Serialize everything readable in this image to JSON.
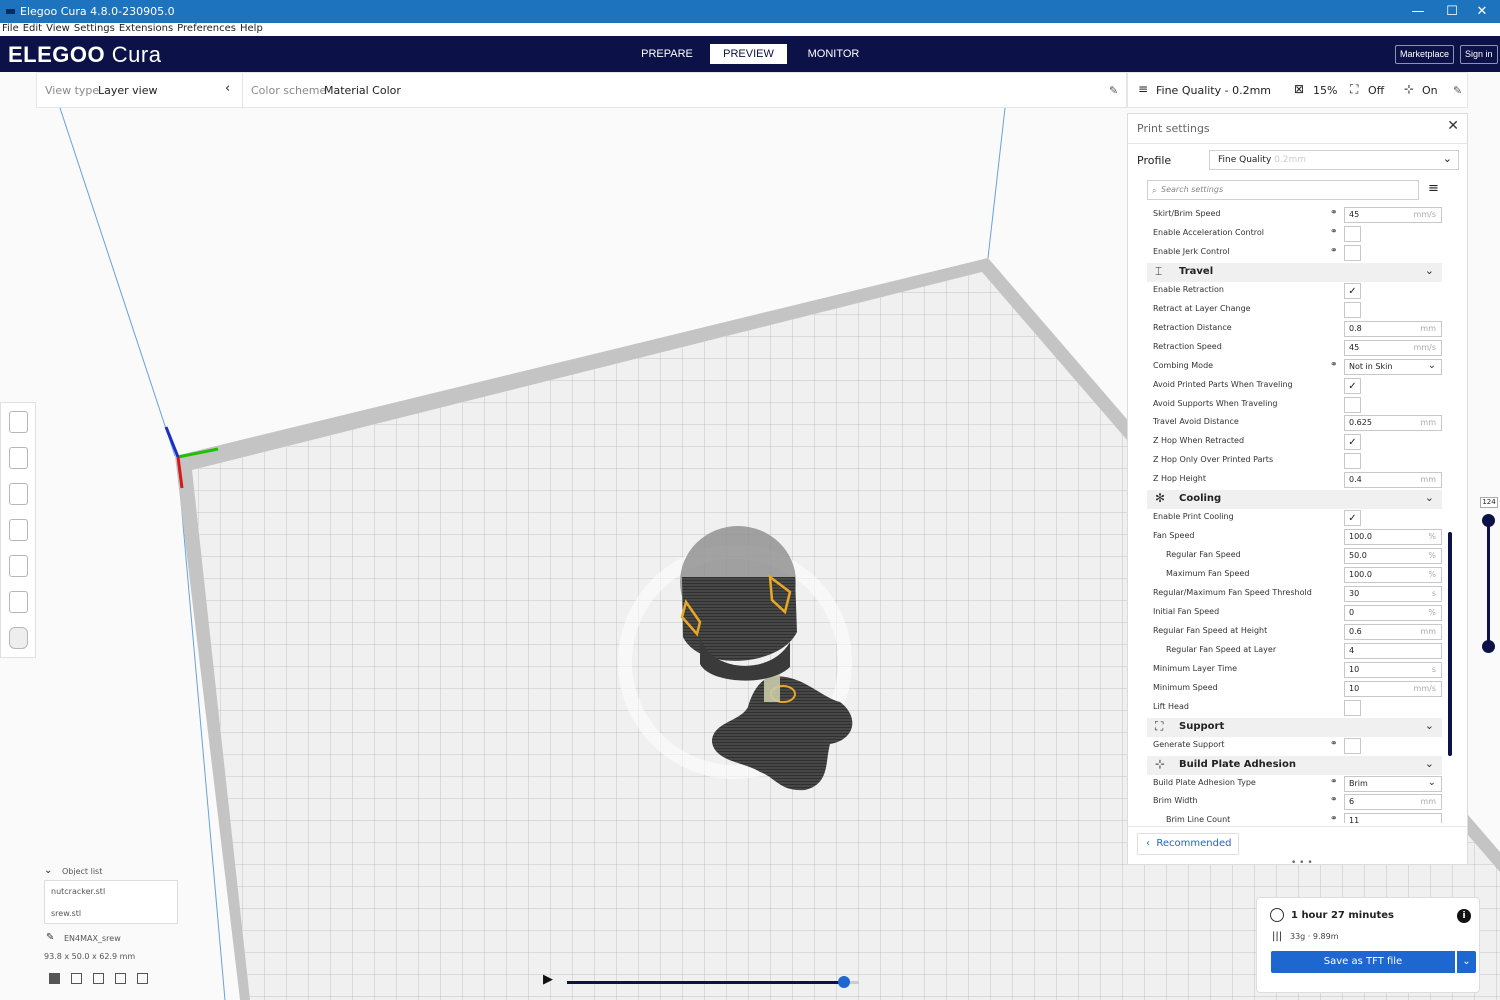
{
  "window": {
    "title": "Elegoo Cura 4.8.0-230905.0",
    "minimize": "—",
    "maximize": "☐",
    "close": "✕"
  },
  "menu": [
    "File",
    "Edit",
    "View",
    "Settings",
    "Extensions",
    "Preferences",
    "Help"
  ],
  "header": {
    "logo_elegoo": "ELEGOO",
    "logo_cura": "Cura",
    "tabs": [
      {
        "label": "PREPARE"
      },
      {
        "label": "PREVIEW",
        "active": true
      },
      {
        "label": "MONITOR"
      }
    ],
    "marketplace": "Marketplace",
    "signin": "Sign in"
  },
  "viewbar": {
    "view_type_label": "View type",
    "view_type_value": "Layer view",
    "color_scheme_label": "Color scheme",
    "color_scheme_value": "Material Color"
  },
  "summary": {
    "profile": "Fine Quality - 0.2mm",
    "infill": "15%",
    "support": "Off",
    "adhesion": "On"
  },
  "print_settings": {
    "title": "Print settings",
    "profile_label": "Profile",
    "profile_value": "Fine Quality",
    "profile_sub": "0.2mm",
    "search_placeholder": "Search settings",
    "recommended": "Recommended",
    "rows": [
      {
        "type": "input",
        "label": "Skirt/Brim Speed",
        "link": true,
        "value": "45",
        "unit": "mm/s"
      },
      {
        "type": "check",
        "label": "Enable Acceleration Control",
        "link": true,
        "checked": false
      },
      {
        "type": "check",
        "label": "Enable Jerk Control",
        "link": true,
        "checked": false
      },
      {
        "type": "cat",
        "label": "Travel",
        "icon": "travel-icon",
        "glyph": "⌶"
      },
      {
        "type": "check",
        "label": "Enable Retraction",
        "checked": true
      },
      {
        "type": "check",
        "label": "Retract at Layer Change",
        "checked": false
      },
      {
        "type": "input",
        "label": "Retraction Distance",
        "value": "0.8",
        "unit": "mm"
      },
      {
        "type": "input",
        "label": "Retraction Speed",
        "value": "45",
        "unit": "mm/s"
      },
      {
        "type": "select",
        "label": "Combing Mode",
        "link": true,
        "value": "Not in Skin"
      },
      {
        "type": "check",
        "label": "Avoid Printed Parts When Traveling",
        "checked": true
      },
      {
        "type": "check",
        "label": "Avoid Supports When Traveling",
        "checked": false
      },
      {
        "type": "input",
        "label": "Travel Avoid Distance",
        "value": "0.625",
        "unit": "mm"
      },
      {
        "type": "check",
        "label": "Z Hop When Retracted",
        "checked": true
      },
      {
        "type": "check",
        "label": "Z Hop Only Over Printed Parts",
        "checked": false
      },
      {
        "type": "input",
        "label": "Z Hop Height",
        "value": "0.4",
        "unit": "mm"
      },
      {
        "type": "cat",
        "label": "Cooling",
        "icon": "cooling-icon",
        "glyph": "✻"
      },
      {
        "type": "check",
        "label": "Enable Print Cooling",
        "checked": true
      },
      {
        "type": "input",
        "label": "Fan Speed",
        "value": "100.0",
        "unit": "%"
      },
      {
        "type": "input",
        "label": "Regular Fan Speed",
        "indent": true,
        "value": "50.0",
        "unit": "%"
      },
      {
        "type": "input",
        "label": "Maximum Fan Speed",
        "indent": true,
        "value": "100.0",
        "unit": "%"
      },
      {
        "type": "input",
        "label": "Regular/Maximum Fan Speed Threshold",
        "value": "30",
        "unit": "s"
      },
      {
        "type": "input",
        "label": "Initial Fan Speed",
        "value": "0",
        "unit": "%"
      },
      {
        "type": "input",
        "label": "Regular Fan Speed at Height",
        "value": "0.6",
        "unit": "mm"
      },
      {
        "type": "input",
        "label": "Regular Fan Speed at Layer",
        "indent": true,
        "value": "4",
        "unit": ""
      },
      {
        "type": "input",
        "label": "Minimum Layer Time",
        "value": "10",
        "unit": "s"
      },
      {
        "type": "input",
        "label": "Minimum Speed",
        "value": "10",
        "unit": "mm/s"
      },
      {
        "type": "check",
        "label": "Lift Head",
        "checked": false
      },
      {
        "type": "cat",
        "label": "Support",
        "icon": "support-icon",
        "glyph": "⛶"
      },
      {
        "type": "check",
        "label": "Generate Support",
        "link": true,
        "checked": false
      },
      {
        "type": "cat",
        "label": "Build Plate Adhesion",
        "icon": "adhesion-icon",
        "glyph": "⊹"
      },
      {
        "type": "select",
        "label": "Build Plate Adhesion Type",
        "link": true,
        "value": "Brim"
      },
      {
        "type": "input",
        "label": "Brim Width",
        "link": true,
        "value": "6",
        "unit": "mm"
      },
      {
        "type": "input",
        "label": "Brim Line Count",
        "link": true,
        "indent": true,
        "value": "11",
        "unit": ""
      }
    ]
  },
  "layer": {
    "value": "124"
  },
  "objects": {
    "header": "Object list",
    "items": [
      "nutcracker.stl",
      "srew.stl"
    ],
    "job_name": "EN4MAX_srew",
    "dims": "93.8 x 50.0 x 62.9 mm"
  },
  "output": {
    "time": "1 hour 27 minutes",
    "material": "33g · 9.89m",
    "save": "Save as TFT file"
  },
  "colors": {
    "accent": "#1e66d0",
    "header": "#0c1247",
    "titlebar": "#1e73be",
    "travel_moves": "#e8a825"
  }
}
